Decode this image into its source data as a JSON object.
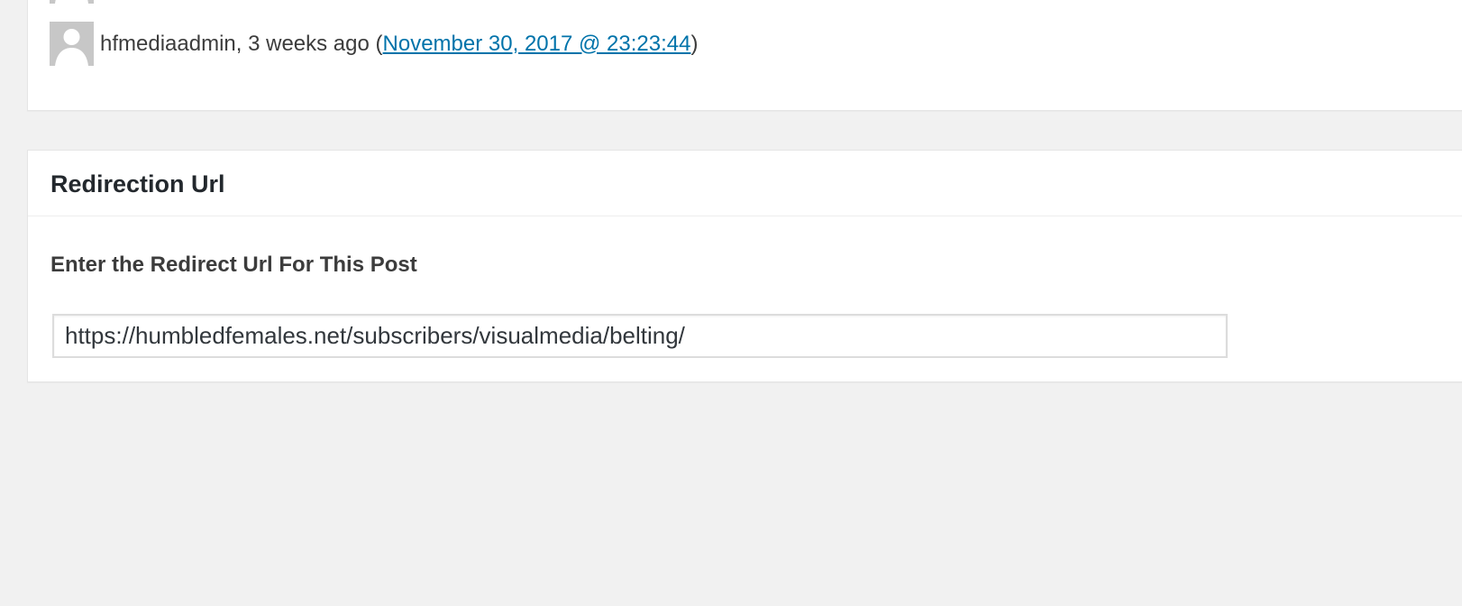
{
  "revisions": {
    "items": [
      {
        "author": "hfmediaadmin",
        "ago": "3 weeks ago",
        "date_link": "November 30, 2017 @ 23:23:44"
      }
    ]
  },
  "redirection": {
    "title": "Redirection Url",
    "field_label": "Enter the Redirect Url For This Post",
    "url_value": "https://humbledfemales.net/subscribers/visualmedia/belting/"
  },
  "colors": {
    "link": "#0073aa",
    "background": "#f1f1f1",
    "avatar": "#c7c7c7"
  }
}
